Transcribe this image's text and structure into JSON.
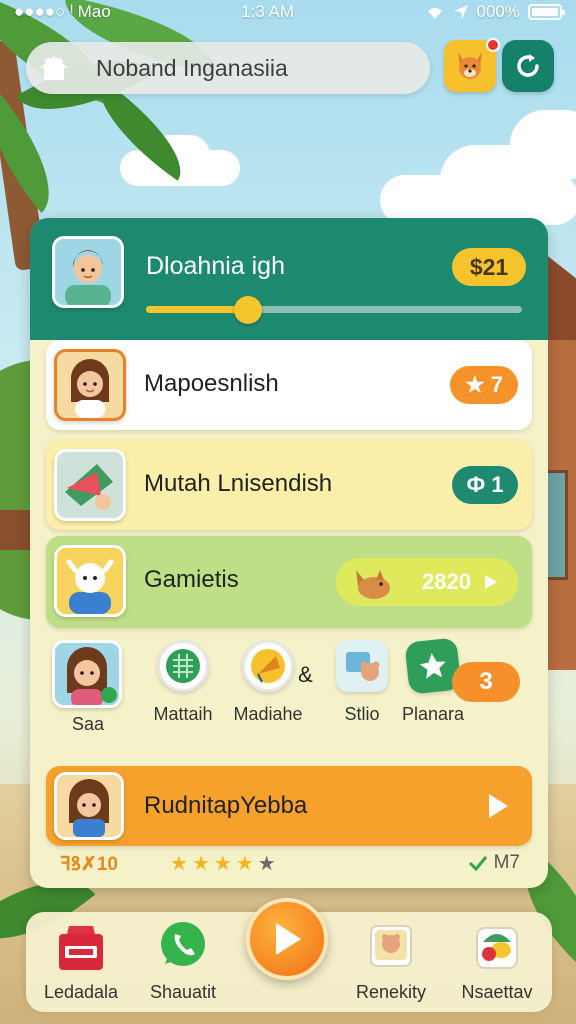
{
  "status_bar": {
    "carrier": "●●●●○ ᴵ Mao",
    "time": "1:3 AM",
    "battery": "000%",
    "battery_level": 1.0
  },
  "top_bar": {
    "title": "Noband Inganasiia",
    "icons": [
      "home-icon",
      "fox-avatar-icon",
      "refresh-icon"
    ]
  },
  "header": {
    "title": "Dloahnia igh",
    "coins": "$21",
    "progress": 0.27
  },
  "rows": [
    {
      "label": "Mapoesnlish",
      "badge": "★ 7"
    },
    {
      "label": "Mutah Lnisendish",
      "badge": "Ф 1"
    },
    {
      "label": "Gamietis",
      "badge": "2820"
    }
  ],
  "strip": {
    "items": [
      {
        "label": "Saa",
        "icon": "girl-avatar-icon"
      },
      {
        "label": "Mattaih",
        "icon": "map-icon"
      },
      {
        "label": "Madiahe",
        "icon": "kite-icon"
      },
      {
        "label": "Stlio",
        "icon": "teddy-icon"
      },
      {
        "label": "Planara",
        "icon": "star-bubble-icon"
      }
    ],
    "ampersand": "&",
    "count": "3"
  },
  "featured": {
    "label": "RudnitapYebba"
  },
  "footer": {
    "score": "ꟻꝸ✗10",
    "rating": 4,
    "rating_max": 5,
    "check_text": "M7"
  },
  "nav": {
    "items": [
      {
        "label": "Ledadala",
        "icon": "cash-register-icon"
      },
      {
        "label": "Shauatit",
        "icon": "phone-icon"
      },
      {
        "label": "Renekity",
        "icon": "photo-icon"
      },
      {
        "label": "Nsaettav",
        "icon": "fruit-basket-icon"
      }
    ]
  },
  "colors": {
    "header_green": "#1d8a70",
    "accent_orange": "#f6a12c",
    "coin_yellow": "#f5c42d"
  }
}
